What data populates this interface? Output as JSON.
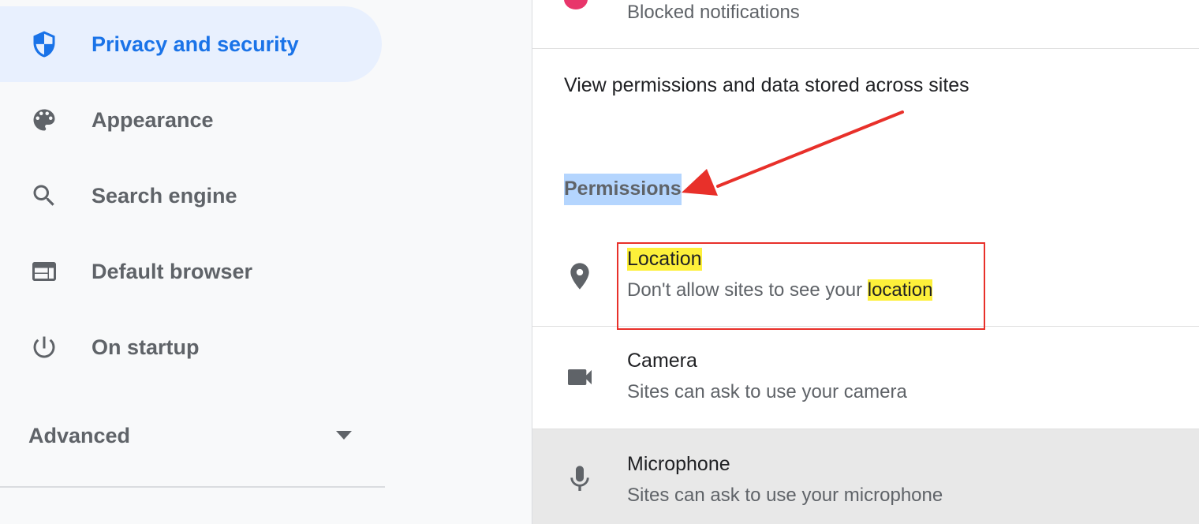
{
  "sidebar": {
    "items": [
      {
        "label": "Privacy and security",
        "icon": "shield-icon",
        "active": true
      },
      {
        "label": "Appearance",
        "icon": "palette-icon",
        "active": false
      },
      {
        "label": "Search engine",
        "icon": "search-icon",
        "active": false
      },
      {
        "label": "Default browser",
        "icon": "browser-window-icon",
        "active": false
      },
      {
        "label": "On startup",
        "icon": "power-icon",
        "active": false
      }
    ],
    "advanced": {
      "label": "Advanced",
      "icon": "caret-down-icon"
    }
  },
  "main": {
    "blocked_notifications": "Blocked notifications",
    "view_permissions_link": "View permissions and data stored across sites",
    "permissions_heading": "Permissions",
    "permissions": [
      {
        "title": "Location",
        "description_prefix": "Don't allow sites to see your ",
        "description_highlight": "location",
        "icon": "location-pin-icon"
      },
      {
        "title": "Camera",
        "description": "Sites can ask to use your camera",
        "icon": "camera-icon"
      },
      {
        "title": "Microphone",
        "description": "Sites can ask to use your microphone",
        "icon": "microphone-icon"
      }
    ]
  },
  "colors": {
    "accent": "#1a73e8",
    "active_bg": "#e8f0fe",
    "search_highlight": "#fdf03a",
    "selection_highlight": "#b4d5fe",
    "annotation_red": "#e8302a",
    "hover_row": "#e8e8e8"
  }
}
